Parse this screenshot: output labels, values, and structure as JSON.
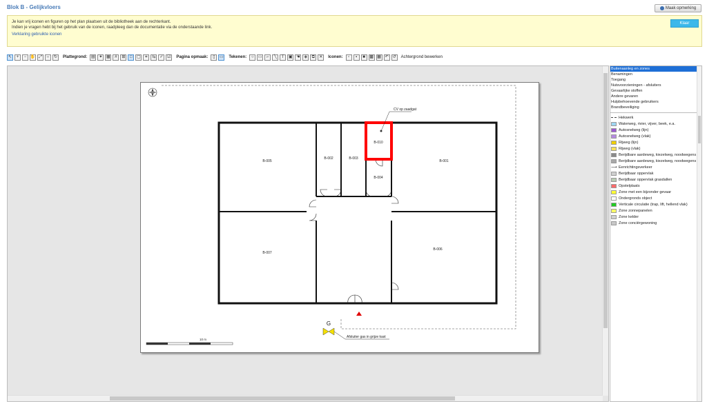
{
  "header": {
    "title": "Blok B - Gelijkvloers",
    "remark_button": "Maak opmerking"
  },
  "info": {
    "line1": "Je kan vrij iconen en figuren op het plan plaatsen uit de bibliotheek aan de rechterkant.",
    "line2": "Indien je vragen hebt bij het gebruik van de iconen, raadpleeg dan de documentatie via de onderstaande link.",
    "link": "Verklaring gebruikte iconen",
    "done_button": "Klaar"
  },
  "toolbar": {
    "floorplan_label": "Plattegrond:",
    "page_layout_label": "Pagina opmaak:",
    "draw_label": "Tekenen:",
    "icons_label": "Iconen:",
    "background_edit": "Achtergrond bewerken"
  },
  "plan": {
    "rooms": [
      "B-005",
      "B-002",
      "B-003",
      "B-010",
      "B-004",
      "B-001",
      "B-007",
      "B-006"
    ],
    "cv_label": "CV op zaadgat",
    "gas_label": "Afsluiter gas in grijze kast",
    "gas_letter": "G",
    "scale_label": "10 m",
    "highlight_color": "#ff0000"
  },
  "library": {
    "categories": [
      "Buitenaanleg en zones",
      "Benamingen",
      "Toegang",
      "Nutsvoorzieningen - afsluiters",
      "Gevaarlijke stoffen",
      "Andere gevaren",
      "Hulpbehoevende gebruikers",
      "Brandbeveiliging"
    ],
    "selected_category": 0,
    "symbols": [
      {
        "label": "Hekwerk",
        "kind": "line-dash",
        "color": "#444444"
      },
      {
        "label": "Waterweg, rivier, vijver, beek, e.a.",
        "kind": "swatch",
        "color": "#9fd6f2"
      },
      {
        "label": "Autosnelweg (lijn)",
        "kind": "swatch",
        "color": "#9b59d0"
      },
      {
        "label": "Autosnelweg (vlak)",
        "kind": "swatch",
        "color": "#b58ae0"
      },
      {
        "label": "Rijweg (lijn)",
        "kind": "swatch",
        "color": "#f0d000"
      },
      {
        "label": "Rijweg (vlak)",
        "kind": "swatch",
        "color": "#f7e05a"
      },
      {
        "label": "Berijdbare aardeweg, kiezelweg, noodwegens (lijn)",
        "kind": "swatch",
        "color": "#8a8a8a"
      },
      {
        "label": "Berijdbare aardeweg, kiezelweg, noodwegens (vlak)",
        "kind": "swatch",
        "color": "#a8a8a8"
      },
      {
        "label": "Eenrichtingsverkeer",
        "kind": "arrow",
        "color": "#444444"
      },
      {
        "label": "Berijdbaar oppervlak",
        "kind": "swatch",
        "color": "#cfcfcf"
      },
      {
        "label": "Berijdbaar oppervlak grasdallen",
        "kind": "swatch",
        "color": "#b9ccb4"
      },
      {
        "label": "Opstelplaats",
        "kind": "swatch",
        "color": "#ff6b6b"
      },
      {
        "label": "Zone met een bijzonder gevaar",
        "kind": "swatch",
        "color": "#ffff33"
      },
      {
        "label": "Ondergronds object",
        "kind": "swatch",
        "color": "#ffffff"
      },
      {
        "label": "Verticale circulatie (trap, lift, hellend vlak)",
        "kind": "swatch",
        "color": "#22cc22"
      },
      {
        "label": "Zone zonnepanelen",
        "kind": "swatch",
        "color": "#ffff66"
      },
      {
        "label": "Zone kelder",
        "kind": "swatch",
        "color": "#d0d0d0"
      },
      {
        "label": "Zone conciërgewoning",
        "kind": "swatch",
        "color": "#c8c8c8"
      }
    ]
  }
}
